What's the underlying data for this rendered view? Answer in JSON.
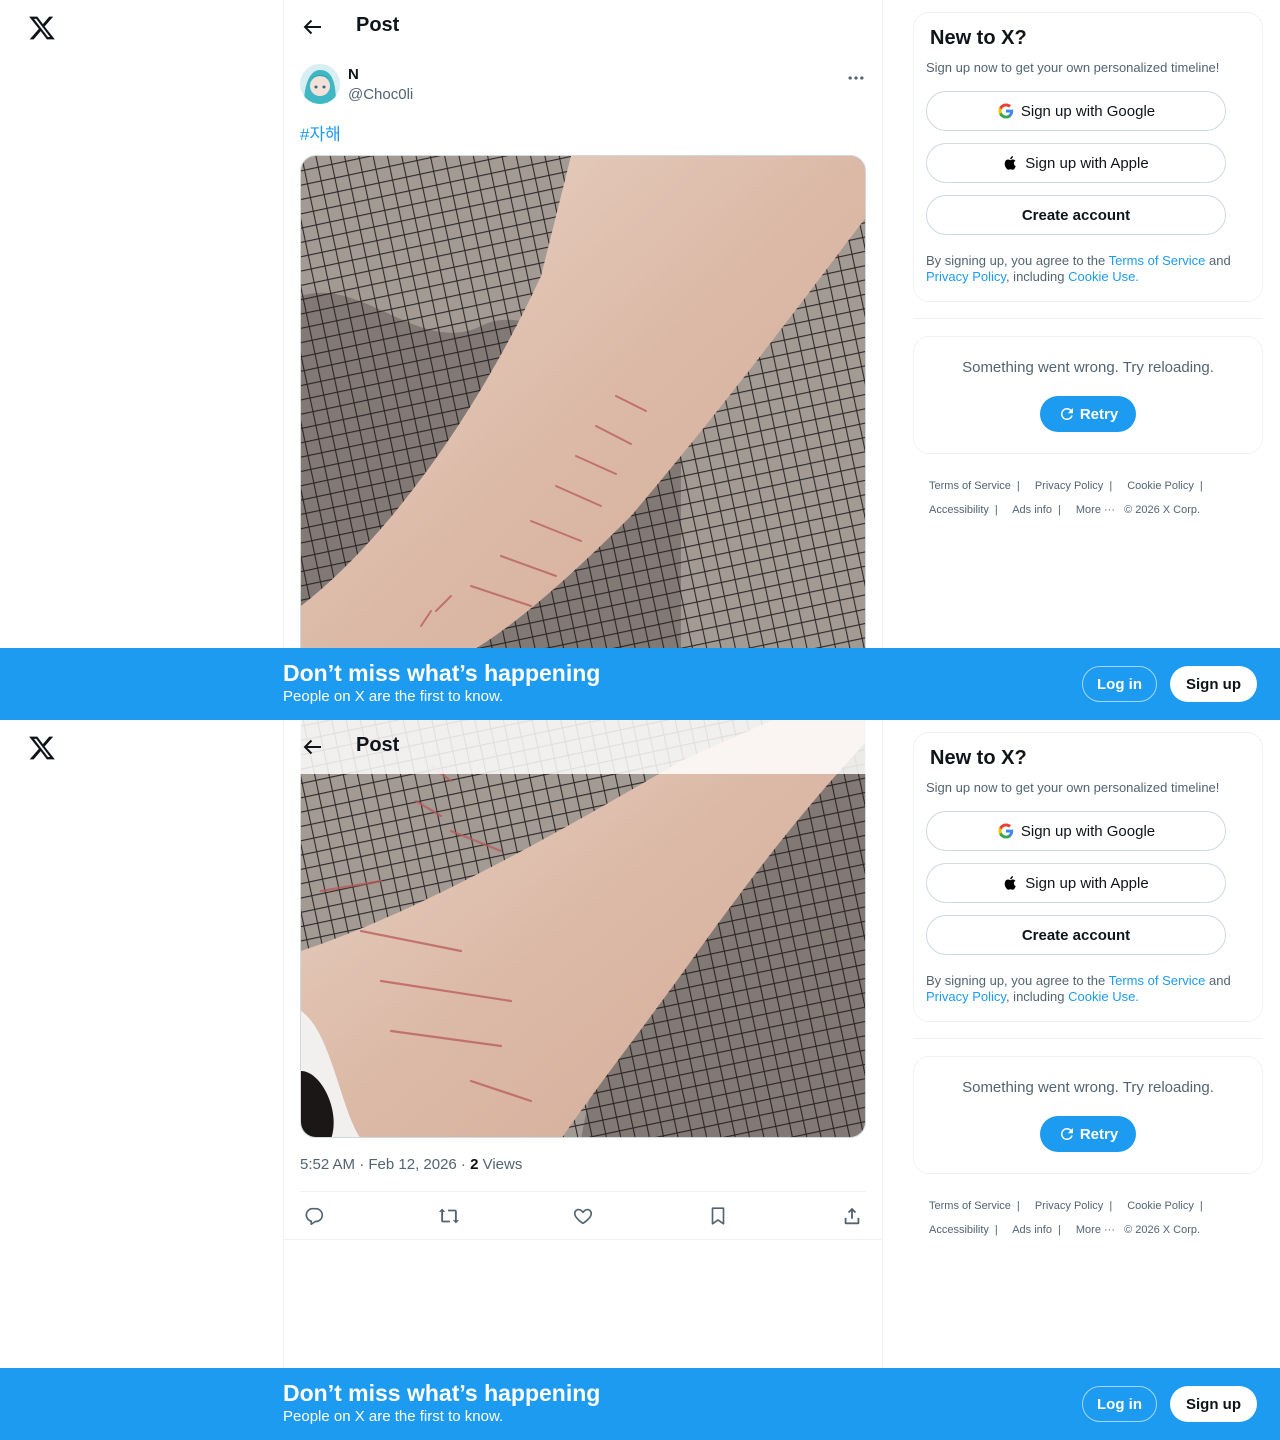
{
  "header": {
    "title": "Post"
  },
  "post": {
    "author_name": "N",
    "author_handle": "@Choc0li",
    "text": "#자해",
    "time": "5:52 AM · Feb 12, 2026 · ",
    "views_count": "2",
    "views_label": " Views"
  },
  "signup": {
    "title": "New to X?",
    "subtitle": "Sign up now to get your own personalized timeline!",
    "google_label": "Sign up with Google",
    "apple_label": "Sign up with Apple",
    "create_label": "Create account",
    "legal_prefix": "By signing up, you agree to the ",
    "terms_link": "Terms of Service",
    "legal_and": " and ",
    "privacy_link": "Privacy Policy",
    "legal_including": ", including ",
    "cookie_link": "Cookie Use."
  },
  "error": {
    "message": "Something went wrong. Try reloading.",
    "retry_label": "Retry"
  },
  "footer": {
    "links": [
      "Terms of Service",
      "Privacy Policy",
      "Cookie Policy",
      "Accessibility",
      "Ads info",
      "More ···"
    ],
    "copyright": "© 2026 X Corp."
  },
  "banner": {
    "title": "Don’t miss what’s happening",
    "subtitle": "People on X are the first to know.",
    "login_label": "Log in",
    "signup_label": "Sign up"
  },
  "colors": {
    "accent": "#1d9bf0",
    "text": "#0f1419",
    "muted": "#536471",
    "border": "#eff3f4"
  },
  "icons": [
    "x-logo-icon",
    "back-arrow-icon",
    "more-icon",
    "google-icon",
    "apple-icon",
    "retry-icon",
    "reply-icon",
    "repost-icon",
    "like-icon",
    "bookmark-icon",
    "share-icon"
  ]
}
